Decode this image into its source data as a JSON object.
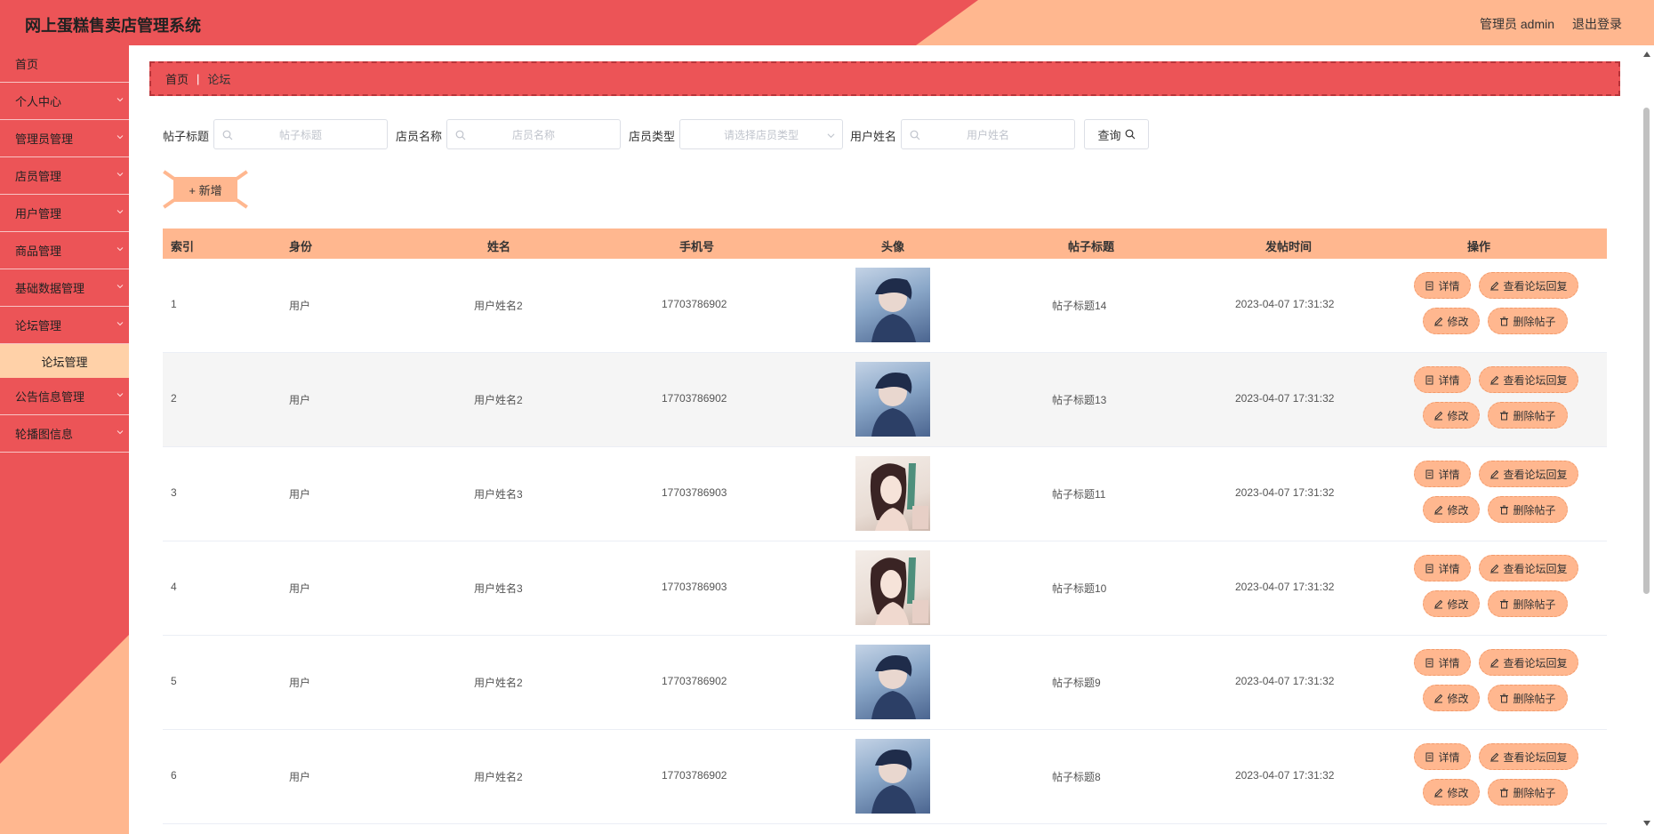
{
  "header": {
    "title": "网上蛋糕售卖店管理系统",
    "user": "管理员 admin",
    "logout": "退出登录"
  },
  "sidebar": {
    "items": [
      {
        "label": "首页",
        "chevron": false
      },
      {
        "label": "个人中心",
        "chevron": true
      },
      {
        "label": "管理员管理",
        "chevron": true
      },
      {
        "label": "店员管理",
        "chevron": true
      },
      {
        "label": "用户管理",
        "chevron": true
      },
      {
        "label": "商品管理",
        "chevron": true
      },
      {
        "label": "基础数据管理",
        "chevron": true
      },
      {
        "label": "论坛管理",
        "chevron": true,
        "expanded": true
      },
      {
        "label": "公告信息管理",
        "chevron": true
      },
      {
        "label": "轮播图信息",
        "chevron": true
      }
    ],
    "submenu": {
      "label": "论坛管理"
    }
  },
  "breadcrumb": {
    "home": "首页",
    "separator": "|",
    "current": "论坛"
  },
  "search": {
    "title_label": "帖子标题",
    "title_placeholder": "帖子标题",
    "staff_name_label": "店员名称",
    "staff_name_placeholder": "店员名称",
    "staff_type_label": "店员类型",
    "staff_type_placeholder": "请选择店员类型",
    "user_name_label": "用户姓名",
    "user_name_placeholder": "用户姓名",
    "query_label": "查询"
  },
  "add_label": "+ 新增",
  "table": {
    "columns": [
      "索引",
      "身份",
      "姓名",
      "手机号",
      "头像",
      "帖子标题",
      "发帖时间",
      "操作"
    ],
    "rows": [
      {
        "index": "1",
        "role": "用户",
        "name": "用户姓名2",
        "phone": "17703786902",
        "avatar": "boy",
        "title": "帖子标题14",
        "time": "2023-04-07 17:31:32"
      },
      {
        "index": "2",
        "role": "用户",
        "name": "用户姓名2",
        "phone": "17703786902",
        "avatar": "boy",
        "title": "帖子标题13",
        "time": "2023-04-07 17:31:32"
      },
      {
        "index": "3",
        "role": "用户",
        "name": "用户姓名3",
        "phone": "17703786903",
        "avatar": "girl",
        "title": "帖子标题11",
        "time": "2023-04-07 17:31:32"
      },
      {
        "index": "4",
        "role": "用户",
        "name": "用户姓名3",
        "phone": "17703786903",
        "avatar": "girl",
        "title": "帖子标题10",
        "time": "2023-04-07 17:31:32"
      },
      {
        "index": "5",
        "role": "用户",
        "name": "用户姓名2",
        "phone": "17703786902",
        "avatar": "boy",
        "title": "帖子标题9",
        "time": "2023-04-07 17:31:32"
      },
      {
        "index": "6",
        "role": "用户",
        "name": "用户姓名2",
        "phone": "17703786902",
        "avatar": "boy",
        "title": "帖子标题8",
        "time": "2023-04-07 17:31:32"
      }
    ],
    "actions": {
      "detail": "详情",
      "view_replies": "查看论坛回复",
      "edit": "修改",
      "delete": "删除帖子"
    }
  },
  "colors": {
    "primary_red": "#ec5457",
    "accent_peach": "#ffb78f",
    "submenu_bg": "#ffd1a8"
  }
}
